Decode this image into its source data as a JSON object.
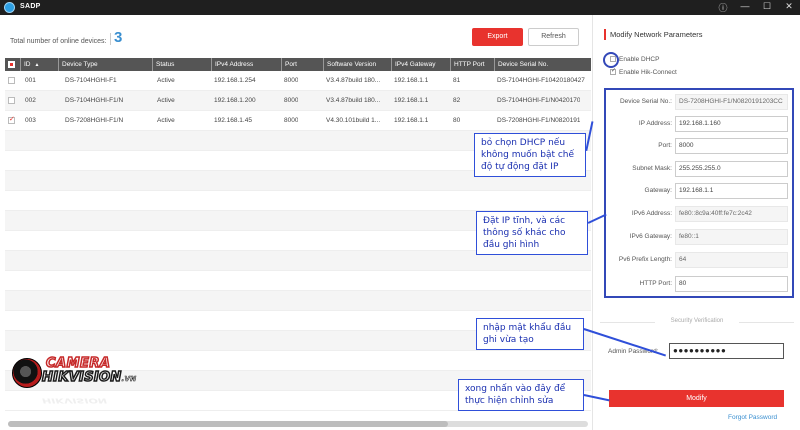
{
  "app": {
    "title": "SADP",
    "window_buttons": [
      "ⓘ",
      "—",
      "☐",
      "✕"
    ]
  },
  "toolbar": {
    "total_label": "Total number of online devices:",
    "total_count": "3",
    "export_label": "Export",
    "refresh_label": "Refresh"
  },
  "table": {
    "headers": [
      "ID",
      "Device Type",
      "Status",
      "IPv4 Address",
      "Port",
      "Software Version",
      "IPv4 Gateway",
      "HTTP Port",
      "Device Serial No."
    ],
    "rows": [
      {
        "id": "001",
        "type": "DS-7104HGHI-F1",
        "status": "Active",
        "ip": "192.168.1.254",
        "port": "8000",
        "sw": "V3.4.87build 180...",
        "gw": "192.168.1.1",
        "http": "81",
        "serial": "DS-7104HGHI-F10420180427",
        "checked": false
      },
      {
        "id": "002",
        "type": "DS-7104HGHI-F1/N",
        "status": "Active",
        "ip": "192.168.1.200",
        "port": "8000",
        "sw": "V3.4.87build 180...",
        "gw": "192.168.1.1",
        "http": "82",
        "serial": "DS-7104HGHI-F1/N0420170",
        "checked": false
      },
      {
        "id": "003",
        "type": "DS-7208HGHI-F1/N",
        "status": "Active",
        "ip": "192.168.1.45",
        "port": "8000",
        "sw": "V4.30.101build 1...",
        "gw": "192.168.1.1",
        "http": "80",
        "serial": "DS-7208HGHI-F1/N0820191",
        "checked": true
      }
    ]
  },
  "panel": {
    "title": "Modify Network Parameters",
    "enable_dhcp": "Enable DHCP",
    "enable_hik": "Enable Hik-Connect",
    "fields": {
      "serial_label": "Device Serial No.:",
      "serial_value": "DS-7208HGHI-F1/N0820191203CC",
      "ip_label": "IP Address:",
      "ip_value": "192.168.1.160",
      "port_label": "Port:",
      "port_value": "8000",
      "mask_label": "Subnet Mask:",
      "mask_value": "255.255.255.0",
      "gw_label": "Gateway:",
      "gw_value": "192.168.1.1",
      "ipv6_label": "IPv6 Address:",
      "ipv6_value": "fe80::8c9a:40ff:fe7c:2c42",
      "ipv6gw_label": "IPv6 Gateway:",
      "ipv6gw_value": "fe80::1",
      "prefix_label": "Pv6 Prefix Length:",
      "prefix_value": "64",
      "http_label": "HTTP Port:",
      "http_value": "80"
    },
    "security_label": "Security Verification",
    "admin_pwd_label": "Admin Password:",
    "admin_pwd_value": "●●●●●●●●●●",
    "modify_label": "Modify",
    "forgot_label": "Forgot Password"
  },
  "annotations": {
    "dhcp": "bỏ chọn DHCP nếu không muốn bật chế độ tự động đặt IP",
    "static_ip": "Đặt IP tĩnh, và các thông số khác cho đầu ghi hình",
    "password": "nhập mật khẩu đầu ghi vừa tạo",
    "modify": "xong nhấn vào đây để thực hiện chỉnh sửa"
  },
  "logo": {
    "top": "CAMERA",
    "bottom": "HIKVISION",
    "suffix": ".VN"
  },
  "colors": {
    "accent": "#e8332e",
    "annotation": "#2f4fd9",
    "count": "#3a8fd0",
    "header": "#555555"
  }
}
